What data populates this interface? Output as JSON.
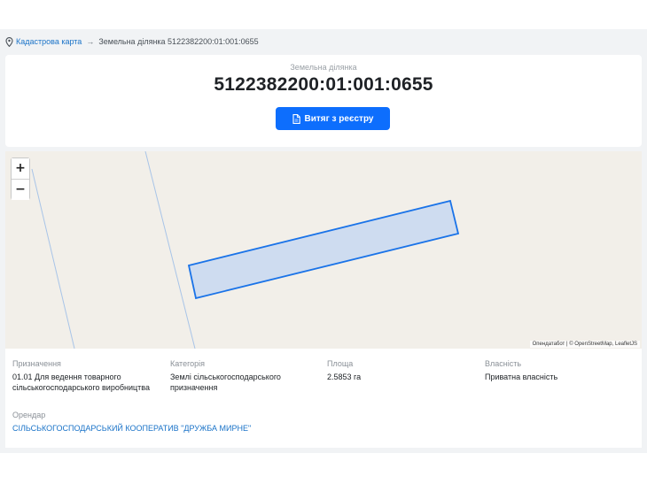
{
  "breadcrumb": {
    "icon": "map-pin-icon",
    "root_label": "Кадастрова карта",
    "separator": "→",
    "current_label": "Земельна ділянка 5122382200:01:001:0655"
  },
  "header": {
    "kicker": "Земельна ділянка",
    "cadastral_number": "5122382200:01:001:0655",
    "extract_button": {
      "label": "Витяг з реєстру",
      "icon": "document-icon"
    }
  },
  "map": {
    "zoom_in_label": "+",
    "zoom_out_label": "−",
    "attribution": "Опендатабот | © OpenStreetMap, LeafletJS",
    "colors": {
      "background": "#f2efe9",
      "parcel_fill": "#cad9f1",
      "parcel_stroke": "#1a73e8",
      "boundary_line": "#a8c4e8"
    }
  },
  "details": {
    "purpose": {
      "label": "Призначення",
      "value": "01.01 Для ведення товарного сільськогосподарського виробництва"
    },
    "category": {
      "label": "Категорія",
      "value": "Землі сільськогосподарського призначення"
    },
    "area": {
      "label": "Площа",
      "value": "2.5853 га"
    },
    "ownership": {
      "label": "Власність",
      "value": "Приватна власність"
    },
    "tenant": {
      "label": "Орендар",
      "value": "СІЛЬСЬКОГОСПОДАРСЬКИЙ КООПЕРАТИВ \"ДРУЖБА МИРНЕ\""
    }
  },
  "colors": {
    "accent": "#0d6efd",
    "link": "#1a73c8"
  }
}
